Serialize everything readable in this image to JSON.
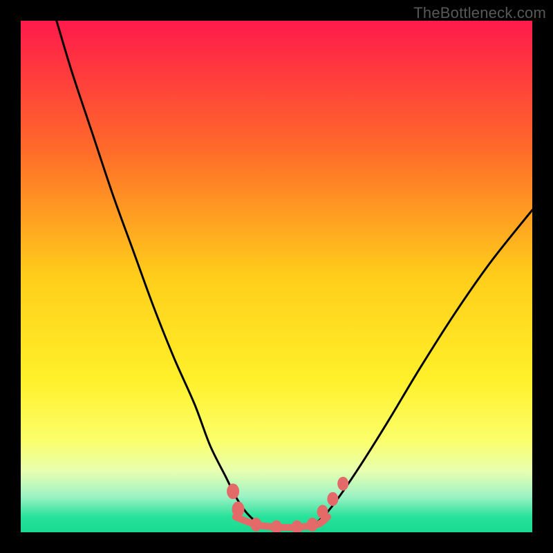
{
  "watermark": "TheBottleneck.com",
  "chart_data": {
    "type": "line",
    "title": "",
    "xlabel": "",
    "ylabel": "",
    "xlim": [
      0,
      100
    ],
    "ylim": [
      0,
      100
    ],
    "grid": false,
    "legend": false,
    "gradient_stops": [
      {
        "offset": 0.0,
        "color": "#ff1a4b"
      },
      {
        "offset": 0.25,
        "color": "#ff6a2a"
      },
      {
        "offset": 0.5,
        "color": "#ffce1a"
      },
      {
        "offset": 0.7,
        "color": "#fff02a"
      },
      {
        "offset": 0.82,
        "color": "#fbff6a"
      },
      {
        "offset": 0.88,
        "color": "#e8ffb0"
      },
      {
        "offset": 0.93,
        "color": "#9cf2c4"
      },
      {
        "offset": 0.97,
        "color": "#27e29a"
      },
      {
        "offset": 1.0,
        "color": "#18d98f"
      }
    ],
    "series": [
      {
        "name": "left-branch",
        "color": "#000000",
        "x": [
          7,
          10,
          14,
          18,
          22,
          26,
          30,
          34,
          37,
          40,
          42,
          44,
          46
        ],
        "y": [
          100,
          90,
          78,
          66,
          55,
          44,
          34,
          25,
          17,
          11,
          7,
          4,
          2
        ]
      },
      {
        "name": "right-branch",
        "color": "#000000",
        "x": [
          58,
          60,
          63,
          67,
          72,
          78,
          85,
          92,
          100
        ],
        "y": [
          2,
          4,
          8,
          14,
          22,
          32,
          43,
          53,
          63
        ]
      },
      {
        "name": "floor-segment",
        "color": "#e46a6a",
        "x": [
          42,
          46,
          50,
          54,
          58,
          60
        ],
        "y": [
          3,
          1.5,
          1,
          1,
          1.5,
          3
        ]
      }
    ],
    "markers": [
      {
        "x": 41.5,
        "y": 8,
        "r": 9
      },
      {
        "x": 42.5,
        "y": 4.5,
        "r": 9
      },
      {
        "x": 46,
        "y": 1.5,
        "r": 8
      },
      {
        "x": 50,
        "y": 1,
        "r": 8
      },
      {
        "x": 54,
        "y": 1,
        "r": 8
      },
      {
        "x": 57,
        "y": 1.5,
        "r": 8
      },
      {
        "x": 59,
        "y": 4,
        "r": 8
      },
      {
        "x": 61,
        "y": 6.5,
        "r": 8
      },
      {
        "x": 63,
        "y": 9.5,
        "r": 8
      }
    ],
    "marker_color": "#e46a6a"
  }
}
